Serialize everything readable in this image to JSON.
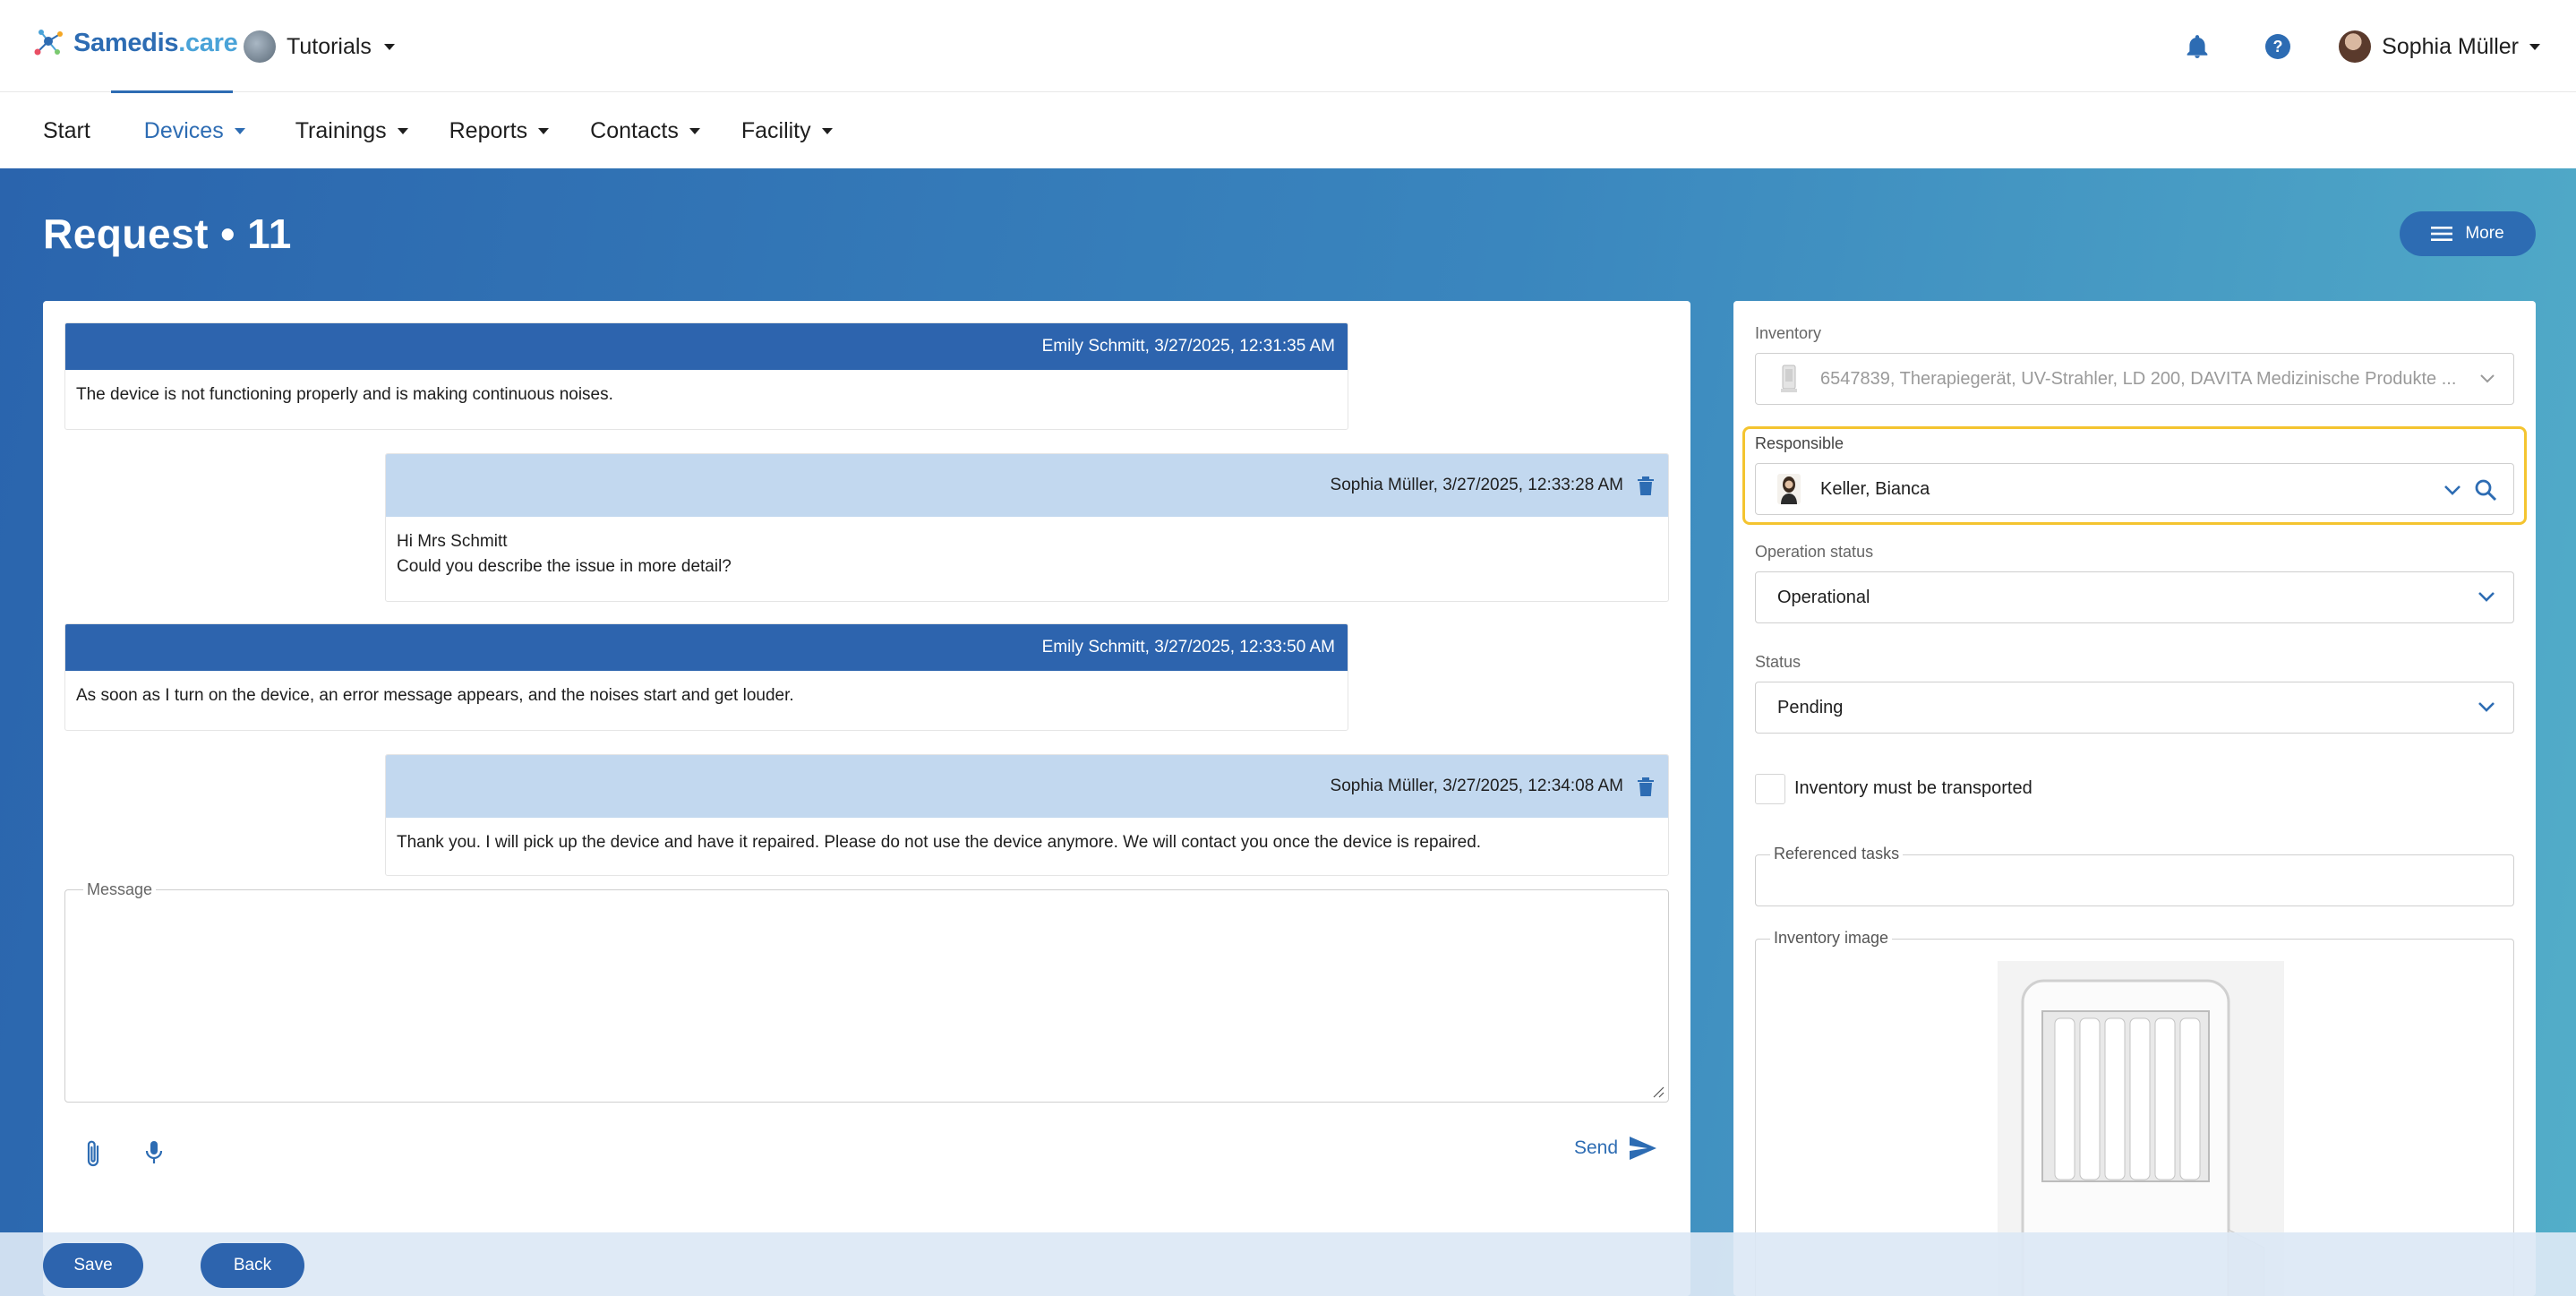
{
  "app": {
    "brand": "Samedis",
    "brand_domain": ".care",
    "tenant": "Tutorials",
    "user": "Sophia Müller"
  },
  "nav": {
    "start": "Start",
    "devices": "Devices",
    "trainings": "Trainings",
    "reports": "Reports",
    "contacts": "Contacts",
    "facility": "Facility"
  },
  "page": {
    "title": "Request • 11",
    "more_label": "More"
  },
  "messages": [
    {
      "author": "Emily Schmitt, 3/27/2025, 12:31:35 AM",
      "lines": [
        "The device is not functioning properly and is making continuous noises."
      ]
    },
    {
      "author": "Sophia Müller, 3/27/2025, 12:33:28 AM",
      "lines": [
        "Hi Mrs Schmitt",
        "Could you describe the issue in more detail?"
      ]
    },
    {
      "author": "Emily Schmitt, 3/27/2025, 12:33:50 AM",
      "lines": [
        "As soon as I turn on the device, an error message appears, and the noises start and get louder."
      ]
    },
    {
      "author": "Sophia Müller, 3/27/2025, 12:34:08 AM",
      "lines": [
        "Thank you. I will pick up the device and have it repaired. Please do not use the device anymore. We will contact you once the device is repaired."
      ]
    }
  ],
  "composer": {
    "label": "Message",
    "value": "",
    "send_label": "Send"
  },
  "details": {
    "inventory_label": "Inventory",
    "inventory_value": "6547839, Therapiegerät, UV-Strahler, LD 200, DAVITA Medizinische Produkte ...",
    "responsible_label": "Responsible",
    "responsible_value": "Keller, Bianca",
    "operation_status_label": "Operation status",
    "operation_status_value": "Operational",
    "status_label": "Status",
    "status_value": "Pending",
    "transport_label": "Inventory must be transported",
    "transport_checked": false,
    "referenced_tasks_label": "Referenced tasks",
    "inventory_image_label": "Inventory image"
  },
  "actions": {
    "save": "Save",
    "back": "Back"
  },
  "colors": {
    "primary": "#2d6cb3",
    "highlight": "#f4c430",
    "sender_header": "#c2d8ef"
  }
}
